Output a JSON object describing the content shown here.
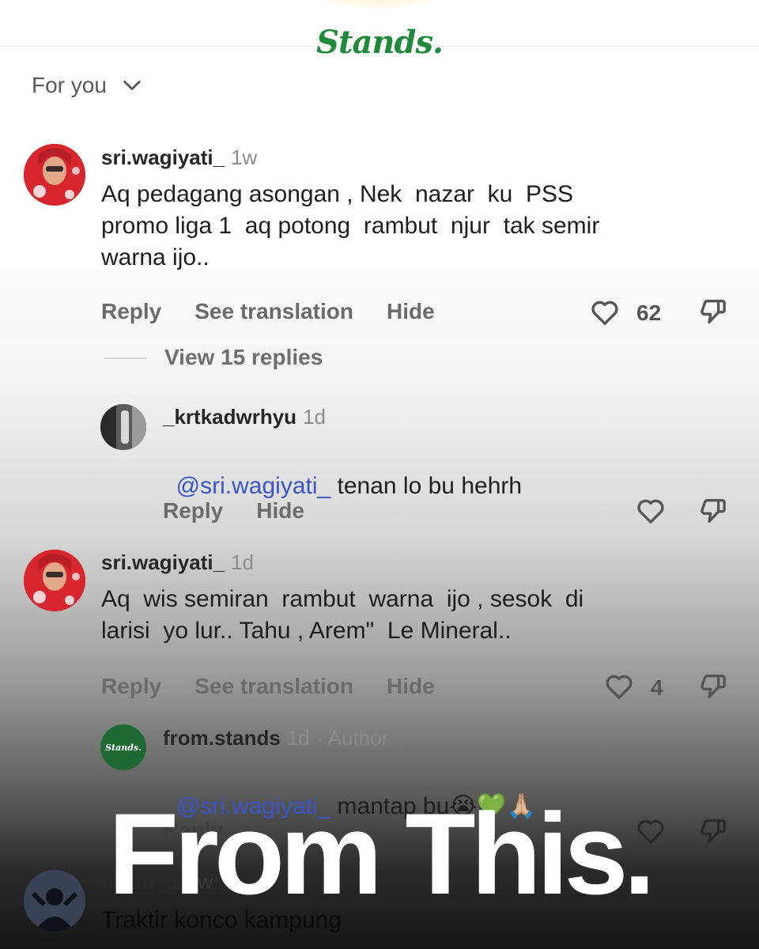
{
  "header": {
    "brand": "Stands.",
    "feed_selector": "For you"
  },
  "comments": [
    {
      "username": "sri.wagiyati_",
      "time": "1w",
      "text": "Aq pedagang asongan , Nek  nazar  ku  PSS\npromo liga 1  aq potong  rambut  njur  tak semir\nwarna ijo..",
      "actions": {
        "reply": "Reply",
        "translate": "See translation",
        "hide": "Hide"
      },
      "likes": "62",
      "view_replies": "View 15 replies"
    },
    {
      "username": "_krtkadwrhyu",
      "time": "1d",
      "mention": "@sri.wagiyati_",
      "text": " tenan lo bu hehrh",
      "actions": {
        "reply": "Reply",
        "hide": "Hide"
      }
    },
    {
      "username": "sri.wagiyati_",
      "time": "1d",
      "text": "Aq  wis semiran  rambut  warna  ijo , sesok  di\nlarisi  yo lur.. Tahu , Arem\"  Le Mineral..",
      "actions": {
        "reply": "Reply",
        "translate": "See translation",
        "hide": "Hide"
      },
      "likes": "4"
    },
    {
      "username": "from.stands",
      "time": "1d",
      "author_tag": "· Author",
      "mention": "@sri.wagiyati_",
      "text": " mantap bu😭💚🙏🏼",
      "avatar_text": "Stands.",
      "actions": {
        "reply": "Reply"
      }
    },
    {
      "username": "nizarr_1",
      "time": "1w",
      "text": "Traktir konco kampung"
    }
  ],
  "overlay_title": "From This.",
  "colors": {
    "brand_green": "#1f8a3a",
    "mention_blue": "#3a55c9",
    "avatar_red": "#d8262e"
  }
}
